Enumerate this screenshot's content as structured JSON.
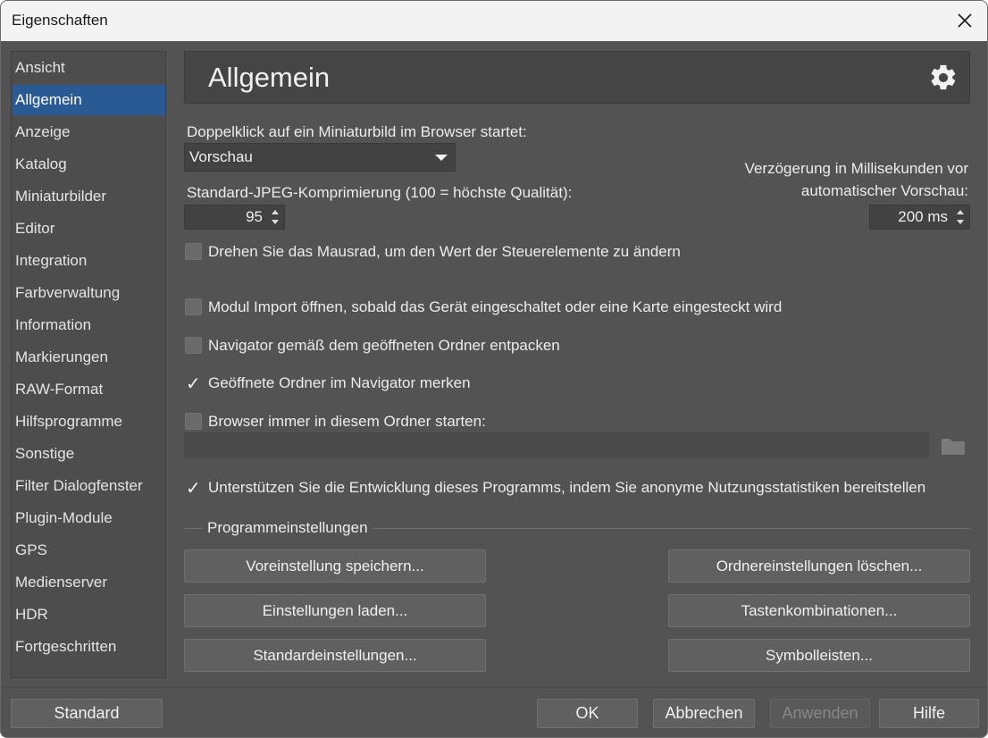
{
  "window": {
    "title": "Eigenschaften"
  },
  "sidebar": {
    "items": [
      {
        "label": "Ansicht"
      },
      {
        "label": "Allgemein",
        "active": true
      },
      {
        "label": "Anzeige"
      },
      {
        "label": "Katalog"
      },
      {
        "label": "Miniaturbilder"
      },
      {
        "label": "Editor"
      },
      {
        "label": "Integration"
      },
      {
        "label": "Farbverwaltung"
      },
      {
        "label": "Information"
      },
      {
        "label": "Markierungen"
      },
      {
        "label": "RAW-Format"
      },
      {
        "label": "Hilfsprogramme"
      },
      {
        "label": "Sonstige"
      },
      {
        "label": "Filter Dialogfenster"
      },
      {
        "label": "Plugin-Module"
      },
      {
        "label": "GPS"
      },
      {
        "label": "Medienserver"
      },
      {
        "label": "HDR"
      },
      {
        "label": "Fortgeschritten"
      }
    ]
  },
  "header": {
    "title": "Allgemein",
    "icon": "gear-icon"
  },
  "doubleclick": {
    "label": "Doppelklick auf ein Miniaturbild im Browser startet:",
    "value": "Vorschau"
  },
  "jpeg": {
    "label": "Standard-JPEG-Komprimierung (100 = höchste Qualität):",
    "value": "95"
  },
  "delay": {
    "label_line1": "Verzögerung in Millisekunden vor",
    "label_line2": "automatischer Vorschau:",
    "value": "200 ms"
  },
  "checkboxes": [
    {
      "label": "Drehen Sie das Mausrad, um den Wert der Steuerelemente zu ändern",
      "checked": false
    },
    {
      "label": "Modul Import öffnen, sobald das Gerät eingeschaltet oder eine Karte eingesteckt wird",
      "checked": false
    },
    {
      "label": "Navigator gemäß dem geöffneten Ordner entpacken",
      "checked": false
    },
    {
      "label": "Geöffnete Ordner im Navigator merken",
      "checked": true
    },
    {
      "label": "Browser immer in diesem Ordner starten:",
      "checked": false
    },
    {
      "label": "Unterstützen Sie die Entwicklung dieses Programms, indem Sie anonyme Nutzungsstatistiken bereitstellen",
      "checked": true
    }
  ],
  "start_folder": {
    "value": ""
  },
  "program_settings": {
    "title": "Programmeinstellungen",
    "buttons": {
      "save_preset": "Voreinstellung speichern...",
      "load_settings": "Einstellungen laden...",
      "default_settings": "Standardeinstellungen...",
      "delete_folder_settings": "Ordnereinstellungen löschen...",
      "shortcuts": "Tastenkombinationen...",
      "toolbars": "Symbolleisten..."
    }
  },
  "footer": {
    "standard": "Standard",
    "ok": "OK",
    "cancel": "Abbrechen",
    "apply": "Anwenden",
    "help": "Hilfe"
  },
  "colors": {
    "background": "#535353",
    "accent": "#2a5a94",
    "titlebar": "#f3f3f3"
  }
}
